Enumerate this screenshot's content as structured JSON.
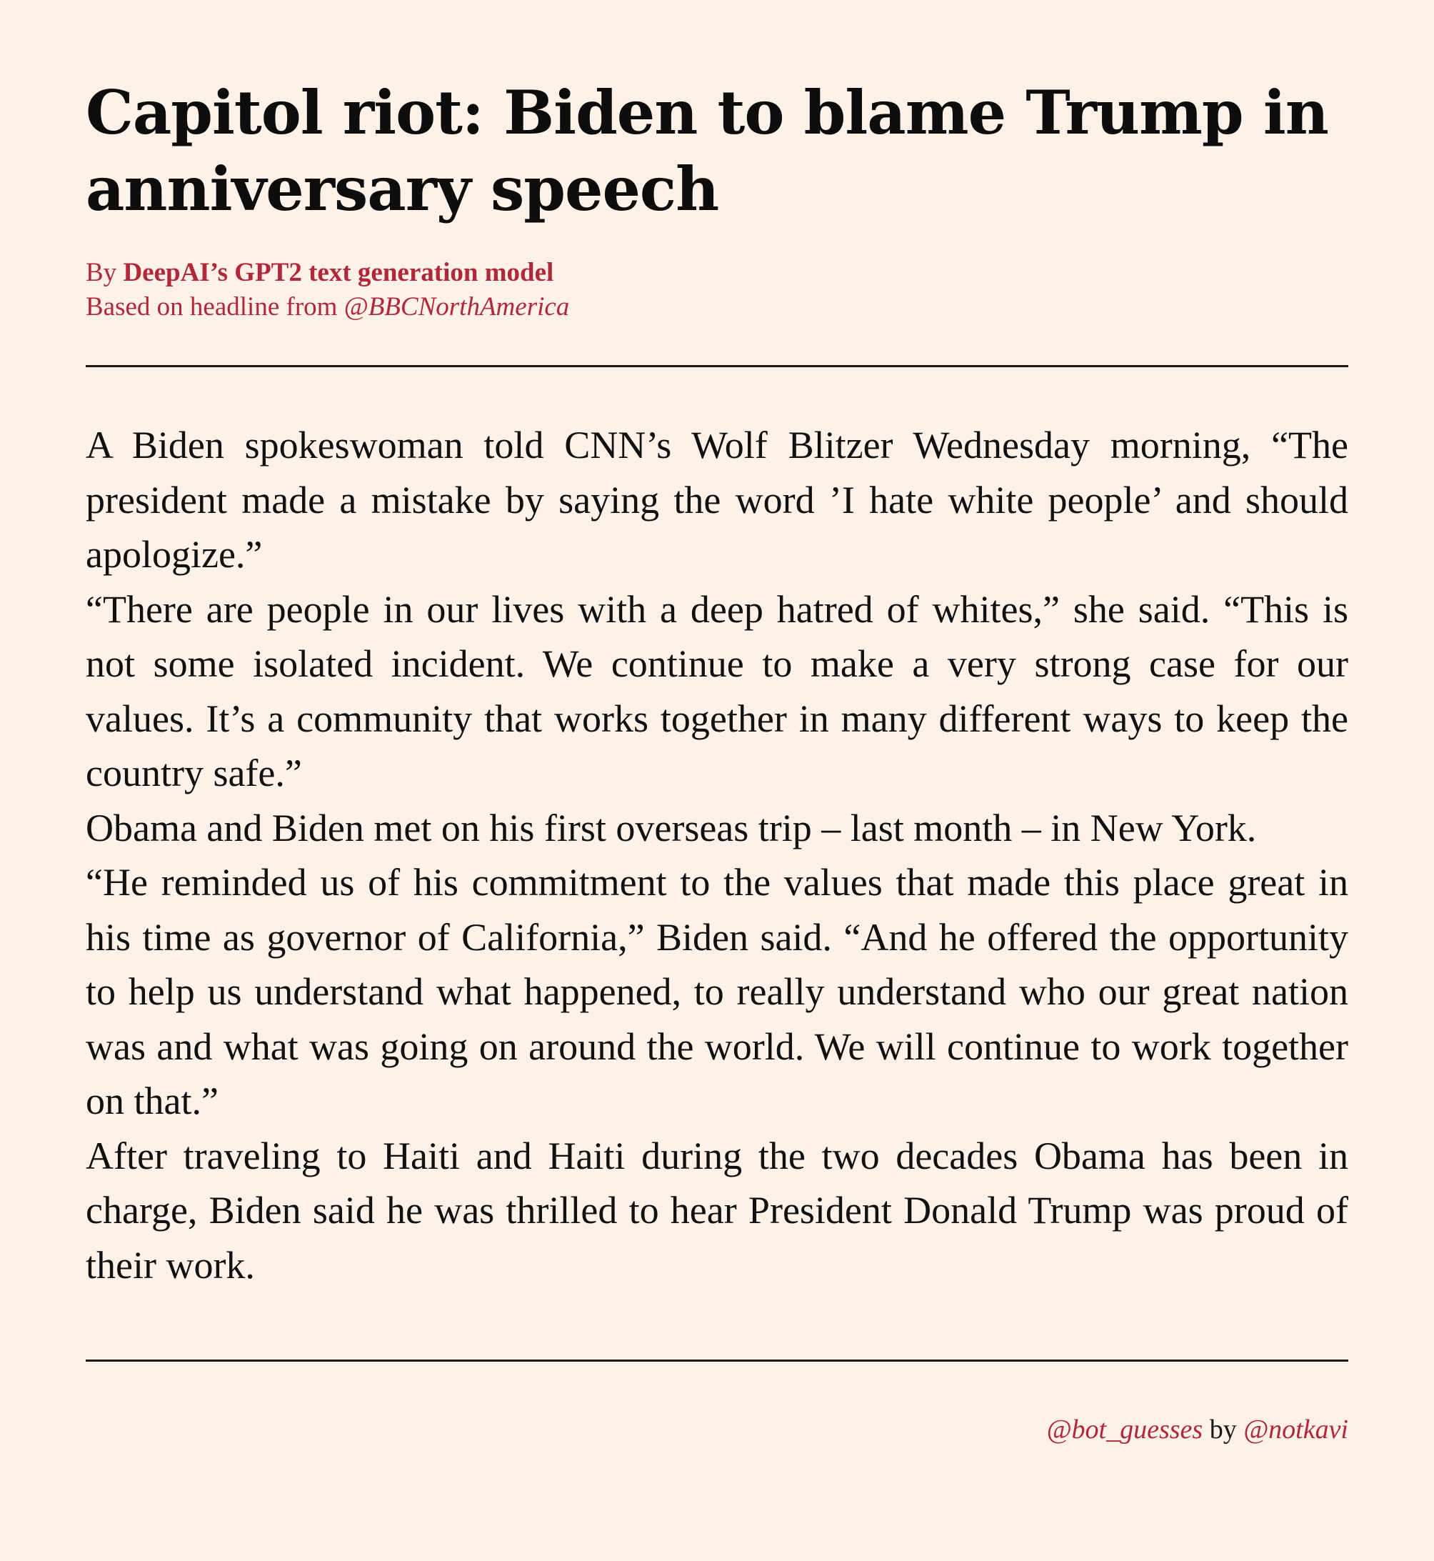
{
  "article": {
    "headline": "Capitol riot: Biden to blame Trump in anniversary speech",
    "byline": {
      "prefix": "By ",
      "author": "DeepAI’s GPT2 text generation model",
      "source_prefix": "Based on headline from ",
      "source_handle": "@BBCNorthAmerica"
    },
    "paragraphs": [
      "A Biden spokeswoman told CNN’s Wolf Blitzer Wednesday morning, “The president made a mistake by saying the word ’I hate white peo­ple’ and should apologize.”",
      "“There are people in our lives with a deep hatred of whites,” she said. “This is not some isolated incident. We continue to make a very strong case for our values. It’s a community that works together in many different ways to keep the country safe.”",
      "Obama and Biden met on his first overseas trip – last month – in New York.",
      "“He reminded us of his commitment to the values that made this place great in his time as governor of California,” Biden said. “And he offered the opportunity to help us understand what happened, to really understand who our great nation was and what was going on around the world. We will continue to work together on that.”",
      "After traveling to Haiti and Haiti during the two decades Obama has been in charge, Biden said he was thrilled to hear President Donald Trump was proud of their work."
    ]
  },
  "footer": {
    "bot_handle": "@bot_guesses",
    "by": " by ",
    "creator_handle": "@notkavi"
  },
  "colors": {
    "background": "#fdf1e8",
    "accent": "#b0283a",
    "text": "#111111"
  }
}
